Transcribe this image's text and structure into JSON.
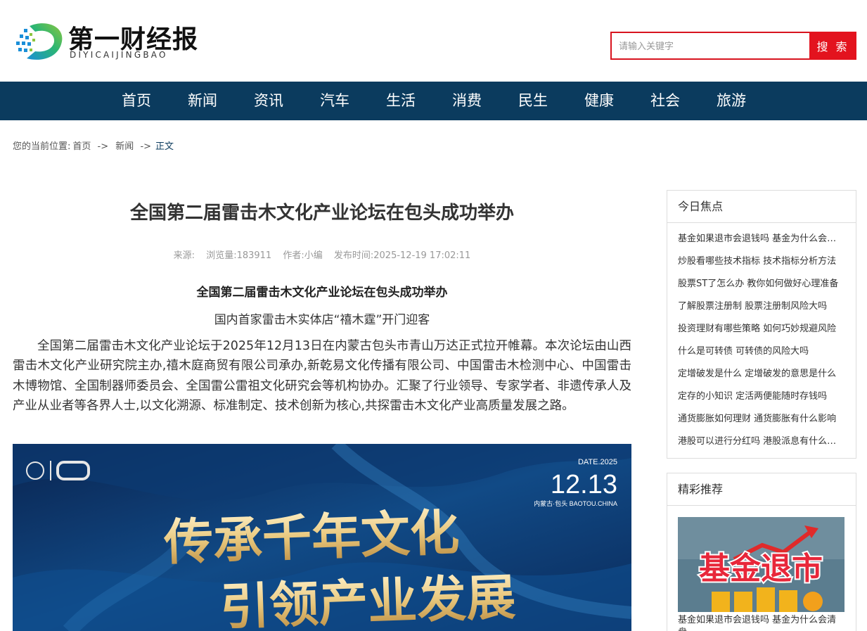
{
  "site": {
    "logo_cn": "第一财经报",
    "logo_en": "DIYICAIJINGBAO"
  },
  "search": {
    "placeholder": "请输入关键字",
    "button": "搜 索"
  },
  "nav": [
    "首页",
    "新闻",
    "资讯",
    "汽车",
    "生活",
    "消费",
    "民生",
    "健康",
    "社会",
    "旅游"
  ],
  "breadcrumb": {
    "prefix": "您的当前位置:",
    "home": "首页",
    "section": "新闻",
    "current": "正文",
    "separator": "->"
  },
  "article": {
    "title": "全国第二届雷击木文化产业论坛在包头成功举办",
    "meta": {
      "source": "来源:",
      "views": "浏览量:183911",
      "author": "作者:小编",
      "published": "发布时间:2025-12-19 17:02:11"
    },
    "subhead": "全国第二届雷击木文化产业论坛在包头成功举办",
    "subline": "国内首家雷击木实体店“禧木霆”开门迎客",
    "paragraph": "全国第二届雷击木文化产业论坛于2025年12月13日在内蒙古包头市青山万达正式拉开帷幕。本次论坛由山西雷击木文化产业研究院主办,禧木庭商贸有限公司承办,新乾易文化传播有限公司、中国雷击木检测中心、中国雷击木博物馆、全国制器师委员会、全国雷公雷祖文化研究会等机构协办。汇聚了行业领导、专家学者、非遗传承人及产业从业者等各界人士,以文化溯源、标准制定、技术创新为核心,共探雷击木文化产业高质量发展之路。",
    "banner": {
      "date_label": "DATE.2025",
      "date": "12.13",
      "location": "内蒙古·包头 BAOTOU.CHINA",
      "line1": "传承千年文化",
      "line2": "引领产业发展"
    }
  },
  "sidebar": {
    "focus_title": "今日焦点",
    "focus_items": [
      "基金如果退市会退钱吗 基金为什么会清盘",
      "炒股看哪些技术指标 技术指标分析方法",
      "股票ST了怎么办 教你如何做好心理准备",
      "了解股票注册制 股票注册制风险大吗",
      "投资理财有哪些策略 如何巧妙规避风险",
      "什么是可转债 可转债的风险大吗",
      "定增破发是什么 定增破发的意思是什么",
      "定存的小知识 定活两便能随时存钱吗",
      "通货膨胀如何理财 通货膨胀有什么影响",
      "港股可以进行分红吗 港股派息有什么规则"
    ],
    "rec_title": "精彩推荐",
    "rec_image_text": "基金退市",
    "rec_caption": "基金如果退市会退钱吗 基金为什么会清盘"
  },
  "colors": {
    "nav_bg": "#0b3b5e",
    "accent_red": "#e3131e"
  }
}
